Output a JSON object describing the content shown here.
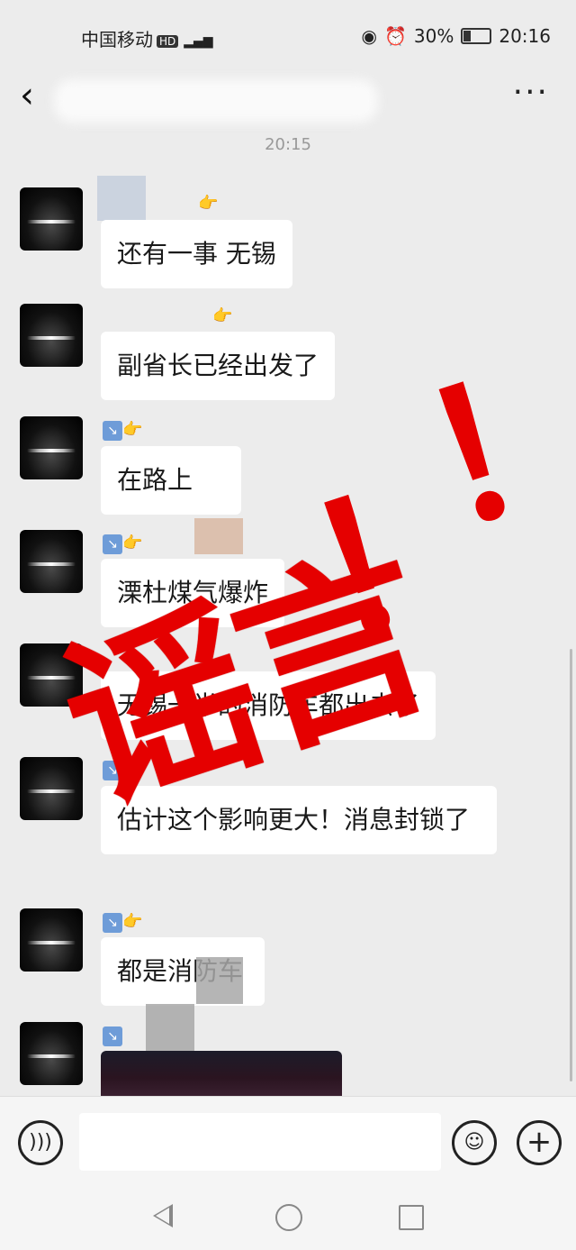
{
  "status_bar": {
    "carrier": "中国移动",
    "network_badge": "HD",
    "network_type": "4G",
    "battery": "30%",
    "battery_level": 0.3,
    "time": "20:16"
  },
  "header": {
    "back_icon": "back-arrow-icon",
    "more_icon": "more-dots-icon"
  },
  "timestamp": "20:15",
  "messages": [
    {
      "text": "还有一事  无锡"
    },
    {
      "text": "副省长已经出发了"
    },
    {
      "text": "在路上"
    },
    {
      "text": "溧杜煤气爆炸"
    },
    {
      "text": "无锡一半的消防车都出去了"
    },
    {
      "text": "估计这个影响更大！消息封锁了"
    },
    {
      "text": "都是消防车"
    },
    {
      "text": ""
    }
  ],
  "stamp": {
    "text": "谣言",
    "bang": "！",
    "color": "#e50000"
  },
  "input_bar": {
    "voice_icon": "voice-icon",
    "emoji_icon": "emoji-icon",
    "plus_icon": "plus-icon"
  },
  "nav_bar": {
    "back_icon": "triangle-back-icon",
    "home_icon": "circle-home-icon",
    "recent_icon": "square-recent-icon"
  }
}
